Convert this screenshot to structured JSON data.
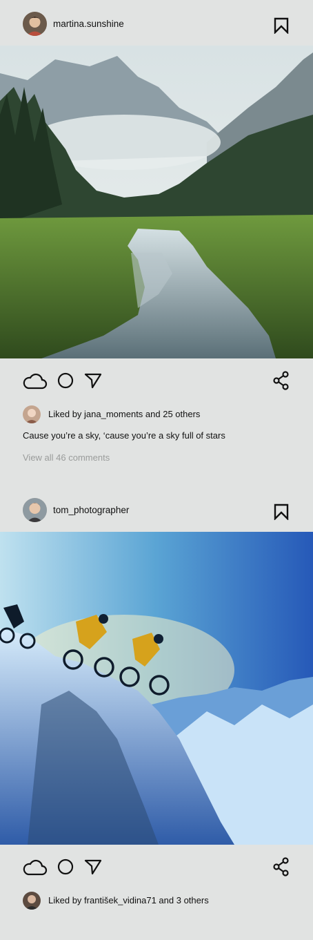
{
  "posts": [
    {
      "username": "martina.sunshine",
      "avatar_alt": "avatar",
      "likes_text": "Liked by jana_moments and 25 others",
      "caption": "Cause you’re a sky, ‘cause you’re a sky full of stars",
      "comments_link": "View all 46 comments"
    },
    {
      "username": "tom_photographer",
      "avatar_alt": "avatar",
      "likes_text": "Liked by františek_vidina71 and 3 others"
    }
  ],
  "icons": {
    "bookmark": "bookmark-icon",
    "like": "cloud-icon",
    "comment": "circle-icon",
    "send": "send-icon",
    "share": "share-icon"
  }
}
